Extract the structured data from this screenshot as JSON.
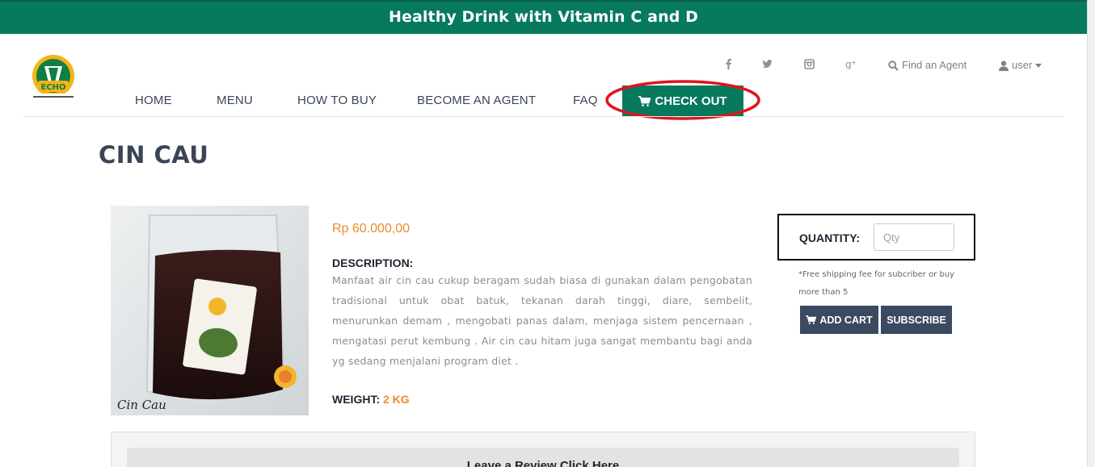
{
  "banner": {
    "text": "Healthy Drink with Vitamin C and D"
  },
  "logo": {
    "alt": "KACAO CHO logo"
  },
  "social": {
    "icons": [
      "facebook-icon",
      "twitter-icon",
      "instagram-icon",
      "google-plus-icon"
    ],
    "find_agent": "Find an Agent",
    "user": "user"
  },
  "nav": {
    "items": [
      "HOME",
      "MENU",
      "HOW TO BUY",
      "BECOME AN AGENT",
      "FAQ"
    ],
    "checkout": "CHECK OUT"
  },
  "product": {
    "title": "CIN CAU",
    "image_caption": "Cin Cau",
    "price": "Rp 60.000,00",
    "description_label": "DESCRIPTION:",
    "description": "Manfaat air cin cau cukup beragam sudah biasa di gunakan dalam pengobatan tradisional untuk obat batuk, tekanan darah tinggi, diare, sembelit, menurunkan demam , mengobati panas dalam, menjaga sistem pencernaan , mengatasi perut kembung . Air cin cau hitam juga sangat membantu bagi anda yg sedang menjalani program diet .",
    "weight_label": "WEIGHT:",
    "weight_value": "2 KG"
  },
  "order": {
    "quantity_label": "QUANTITY:",
    "quantity_placeholder": "Qty",
    "shipping_note": "*Free shipping fee for subcriber or buy more than 5",
    "add_cart": "ADD CART",
    "subscribe": "SUBSCRIBE"
  },
  "review": {
    "button": "Leave a Review Click Here"
  },
  "colors": {
    "brand_green": "#077a5d",
    "accent_orange": "#ef8a2c",
    "dark_button": "#3b4a61",
    "highlight_red": "#e0141e"
  }
}
